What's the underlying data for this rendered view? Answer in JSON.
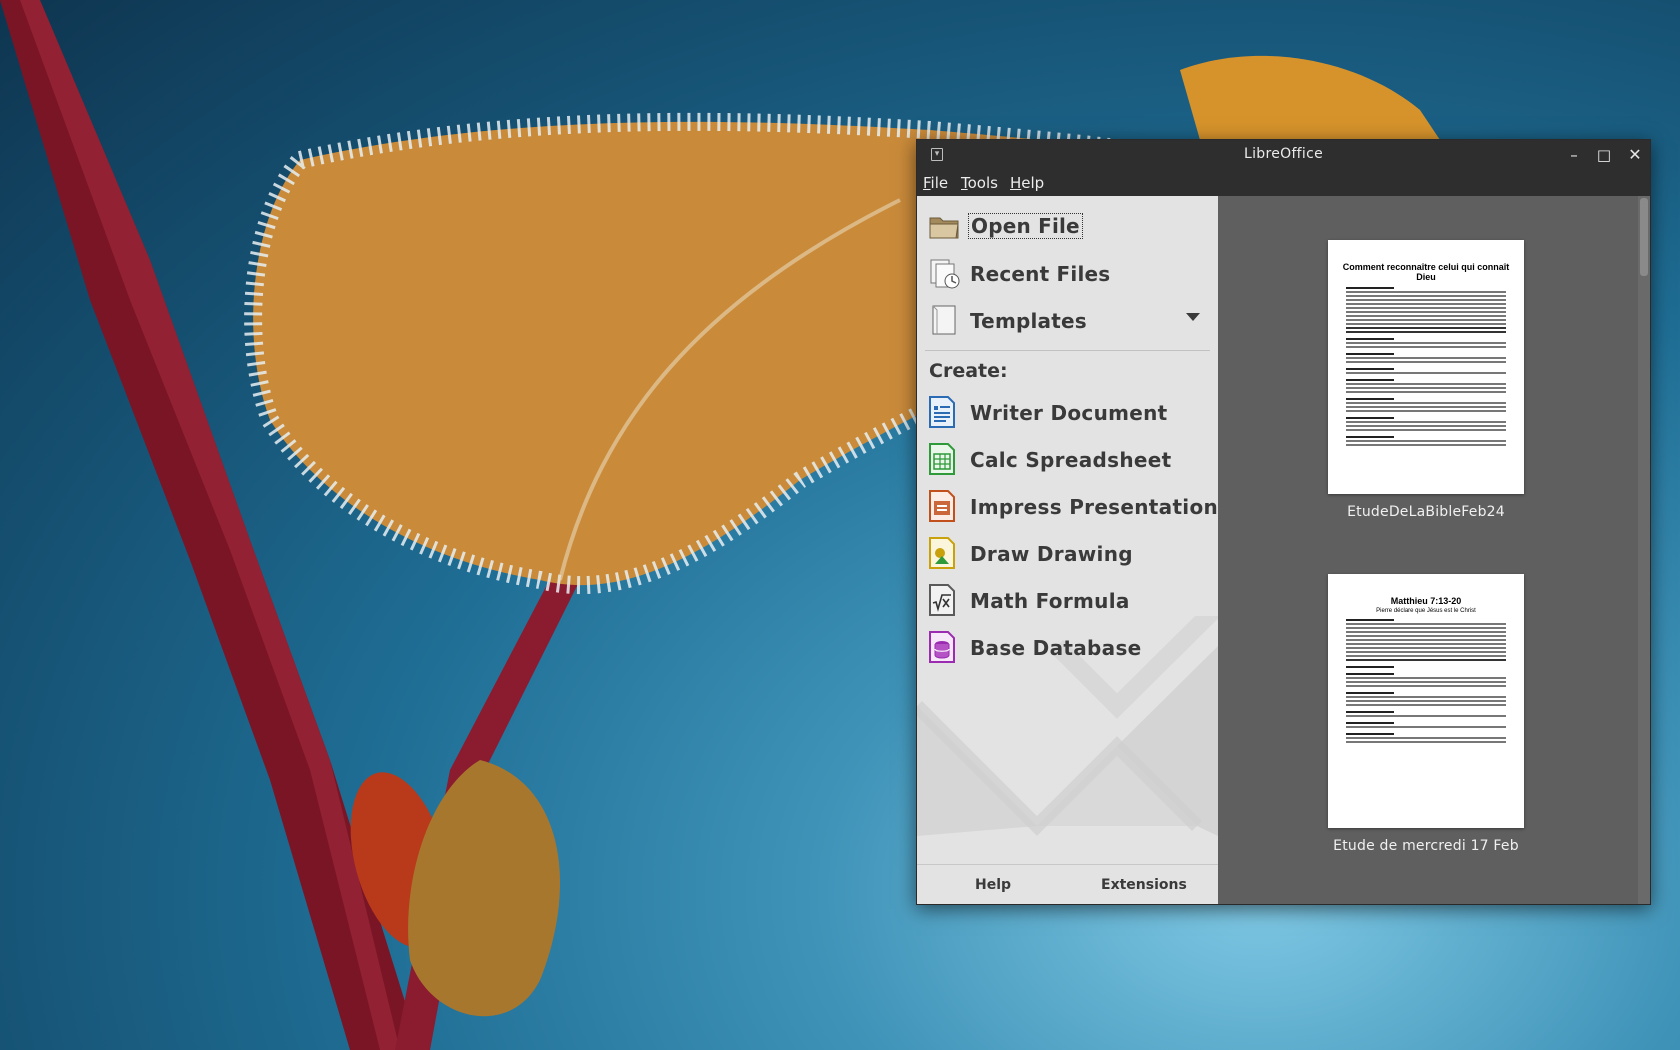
{
  "window": {
    "title": "LibreOffice",
    "controls": {
      "minimize": "–",
      "maximize": "□",
      "close": "✕"
    }
  },
  "menu": {
    "file": {
      "first": "F",
      "rest": "ile"
    },
    "tools": {
      "first": "T",
      "rest": "ools"
    },
    "help": {
      "first": "H",
      "rest": "elp"
    }
  },
  "nav": {
    "open_file": "Open File",
    "recent_files": "Recent Files",
    "templates": "Templates",
    "create_heading": "Create:"
  },
  "create": {
    "writer": "Writer Document",
    "calc": "Calc Spreadsheet",
    "impress": "Impress Presentation",
    "draw": "Draw Drawing",
    "math": "Math Formula",
    "base": "Base Database"
  },
  "bottom": {
    "help": "Help",
    "extensions": "Extensions"
  },
  "recent_documents": [
    {
      "label": "EtudeDeLaBibleFeb24",
      "title": "Comment reconnaître  celui qui connaît Dieu",
      "subtitle": ""
    },
    {
      "label": "Etude de mercredi 17 Feb",
      "title": "Matthieu 7:13-20",
      "subtitle": "Pierre déclare que Jésus est le Christ"
    }
  ],
  "colors": {
    "titlebar": "#2e2e2e",
    "left_panel": "#e3e3e3",
    "right_panel": "#5f5f5f",
    "writer": "#2a6bb3",
    "calc": "#2e9a3a",
    "impress": "#c2501d",
    "draw": "#c9a10d",
    "math": "#5a5a5a",
    "base": "#9b2bb0"
  }
}
